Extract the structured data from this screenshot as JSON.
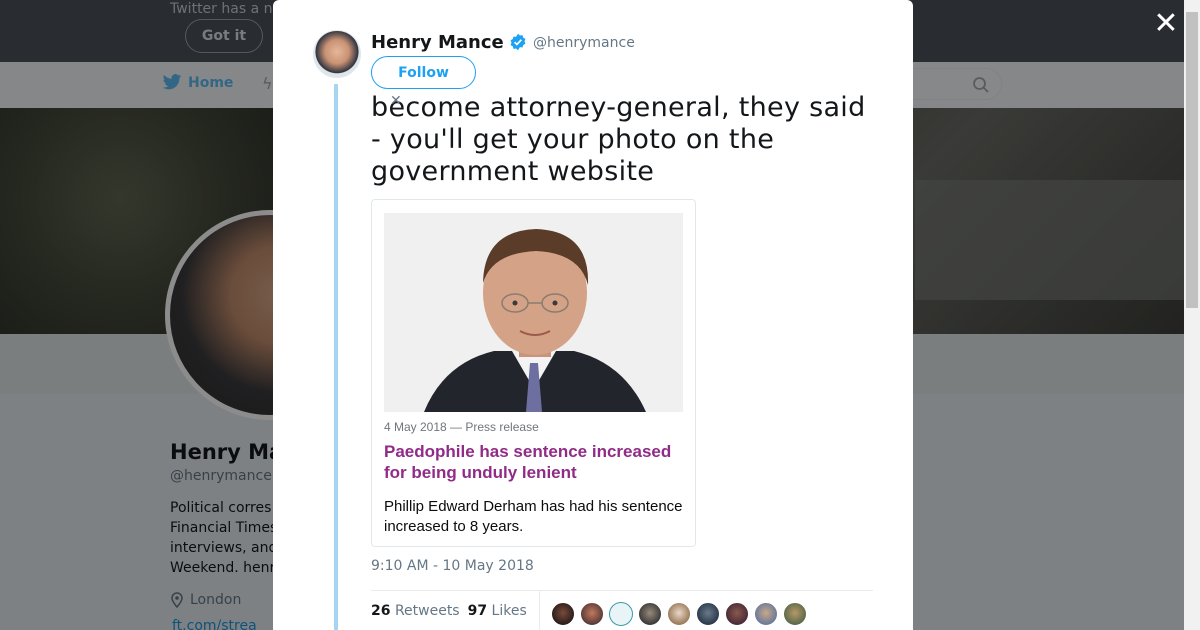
{
  "background": {
    "notice_text": "Twitter has a n",
    "got_it_label": "Got it",
    "nav_home_label": "Home",
    "profile_name": "Henry Ma",
    "profile_handle": "@henrymance",
    "bio_lines": [
      "Political corres",
      "Financial Times",
      "interviews, and",
      "Weekend. henr"
    ],
    "location": "London",
    "link": "ft.com/strea"
  },
  "tweet": {
    "author_name": "Henry Mance",
    "author_handle": "@henrymance",
    "follow_label": "Follow",
    "text": "become attorney-general, they said - you'll get your photo on the government website",
    "timestamp": "9:10 AM - 10 May 2018",
    "retweets_count": "26",
    "retweets_label": "Retweets",
    "likes_count": "97",
    "likes_label": "Likes",
    "card": {
      "date_line": "4 May 2018 — Press release",
      "title": "Paedophile has sentence increased for being unduly lenient",
      "description": "Phillip Edward Derham has had his sentence increased to 8 years."
    }
  },
  "colors": {
    "accent": "#1da1f2",
    "card_title": "#912b88",
    "thread_line": "#a6d4f2"
  },
  "icons": {
    "close": "close-icon",
    "verified": "verified-badge-icon",
    "search": "search-icon",
    "location": "location-pin-icon",
    "home": "twitter-bird-icon"
  }
}
